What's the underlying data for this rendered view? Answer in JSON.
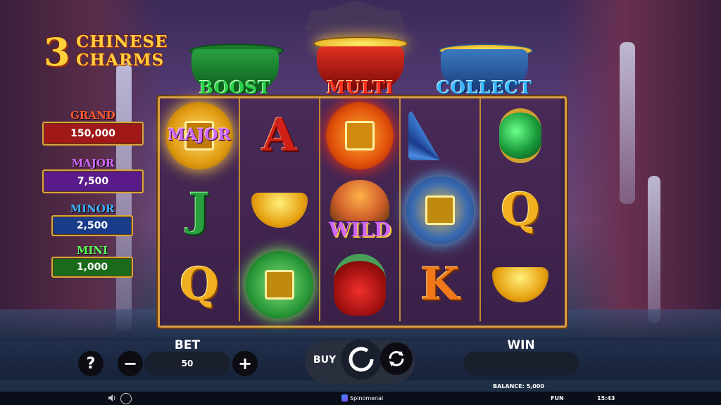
{
  "logo": {
    "number": "3",
    "word1": "CHINESE",
    "word2": "CHARMS"
  },
  "jackpots": [
    {
      "name": "GRAND",
      "value": "150,000",
      "title_color": "#ff5a2a",
      "box_color": "#a01818"
    },
    {
      "name": "MAJOR",
      "value": "7,500",
      "title_color": "#d068ff",
      "box_color": "#5a1a8a"
    },
    {
      "name": "MINOR",
      "value": "2,500",
      "title_color": "#3ab0ff",
      "box_color": "#1a3a8a"
    },
    {
      "name": "MINI",
      "value": "1,000",
      "title_color": "#5aff5a",
      "box_color": "#1a6a1a"
    }
  ],
  "pots": [
    {
      "label": "BOOST",
      "color": "#2ad04a"
    },
    {
      "label": "MULTI",
      "color": "#ff3020"
    },
    {
      "label": "COLLECT",
      "color": "#3ab8ff"
    }
  ],
  "reels": [
    [
      "major-coin",
      "J",
      "Q"
    ],
    [
      "A",
      "gold-ingot",
      "green-coin"
    ],
    [
      "red-coin",
      "wild-tree",
      "red-money-bag"
    ],
    [
      "blue-fan",
      "blue-coin",
      "K"
    ],
    [
      "green-lantern",
      "Q",
      "gold-ingot"
    ]
  ],
  "symbols": {
    "major_label": "MAJOR",
    "wild_label": "WILD"
  },
  "controls": {
    "bet_label": "BET",
    "bet_value": "50",
    "win_label": "WIN",
    "win_value": "",
    "help": "?",
    "minus": "−",
    "plus": "+",
    "buy": "BUY"
  },
  "status": {
    "balance": "BALANCE: 5,000",
    "brand": "Spinomenal",
    "mode": "FUN",
    "time": "15:43"
  }
}
